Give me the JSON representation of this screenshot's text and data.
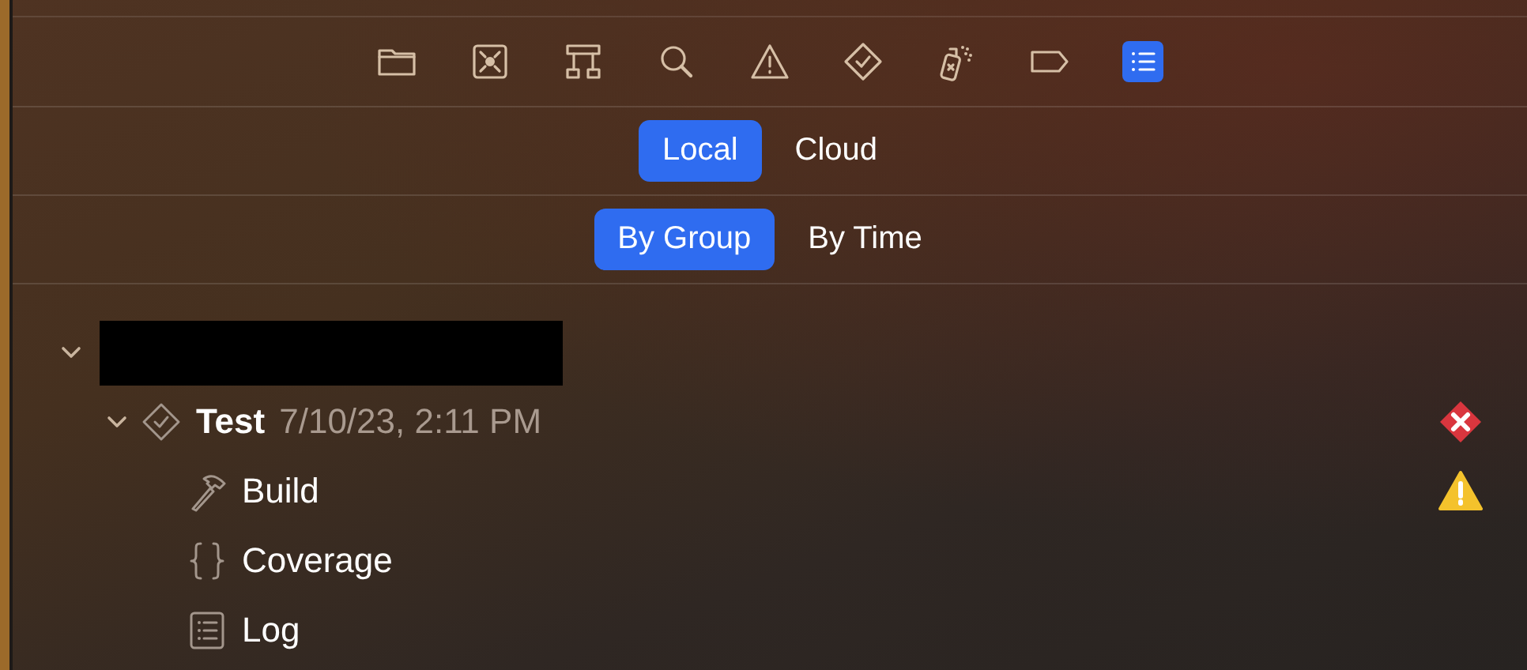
{
  "toolbar": [
    {
      "kind": "folder",
      "selected": false
    },
    {
      "kind": "source-control",
      "selected": false
    },
    {
      "kind": "hierarchy",
      "selected": false
    },
    {
      "kind": "search",
      "selected": false
    },
    {
      "kind": "issue",
      "selected": false
    },
    {
      "kind": "test",
      "selected": false
    },
    {
      "kind": "debug",
      "selected": false
    },
    {
      "kind": "breakpoint",
      "selected": false
    },
    {
      "kind": "report",
      "selected": true
    }
  ],
  "location_tabs": [
    {
      "label": "Local",
      "selected": true
    },
    {
      "label": "Cloud",
      "selected": false
    }
  ],
  "grouping_tabs": [
    {
      "label": "By Group",
      "selected": true
    },
    {
      "label": "By Time",
      "selected": false
    }
  ],
  "tree": [
    {
      "redacted": true,
      "expanded": true,
      "children": [
        {
          "kind": "test",
          "label": "Test",
          "time": "7/10/23, 2:11 PM",
          "error": true,
          "warning": false,
          "expanded": true,
          "children": [
            {
              "kind": "build",
              "label": "Build",
              "error": false,
              "warning": true
            },
            {
              "kind": "coverage",
              "label": "Coverage",
              "error": false,
              "warning": false
            },
            {
              "kind": "log",
              "label": "Log",
              "error": false,
              "warning": false
            }
          ]
        }
      ]
    }
  ]
}
